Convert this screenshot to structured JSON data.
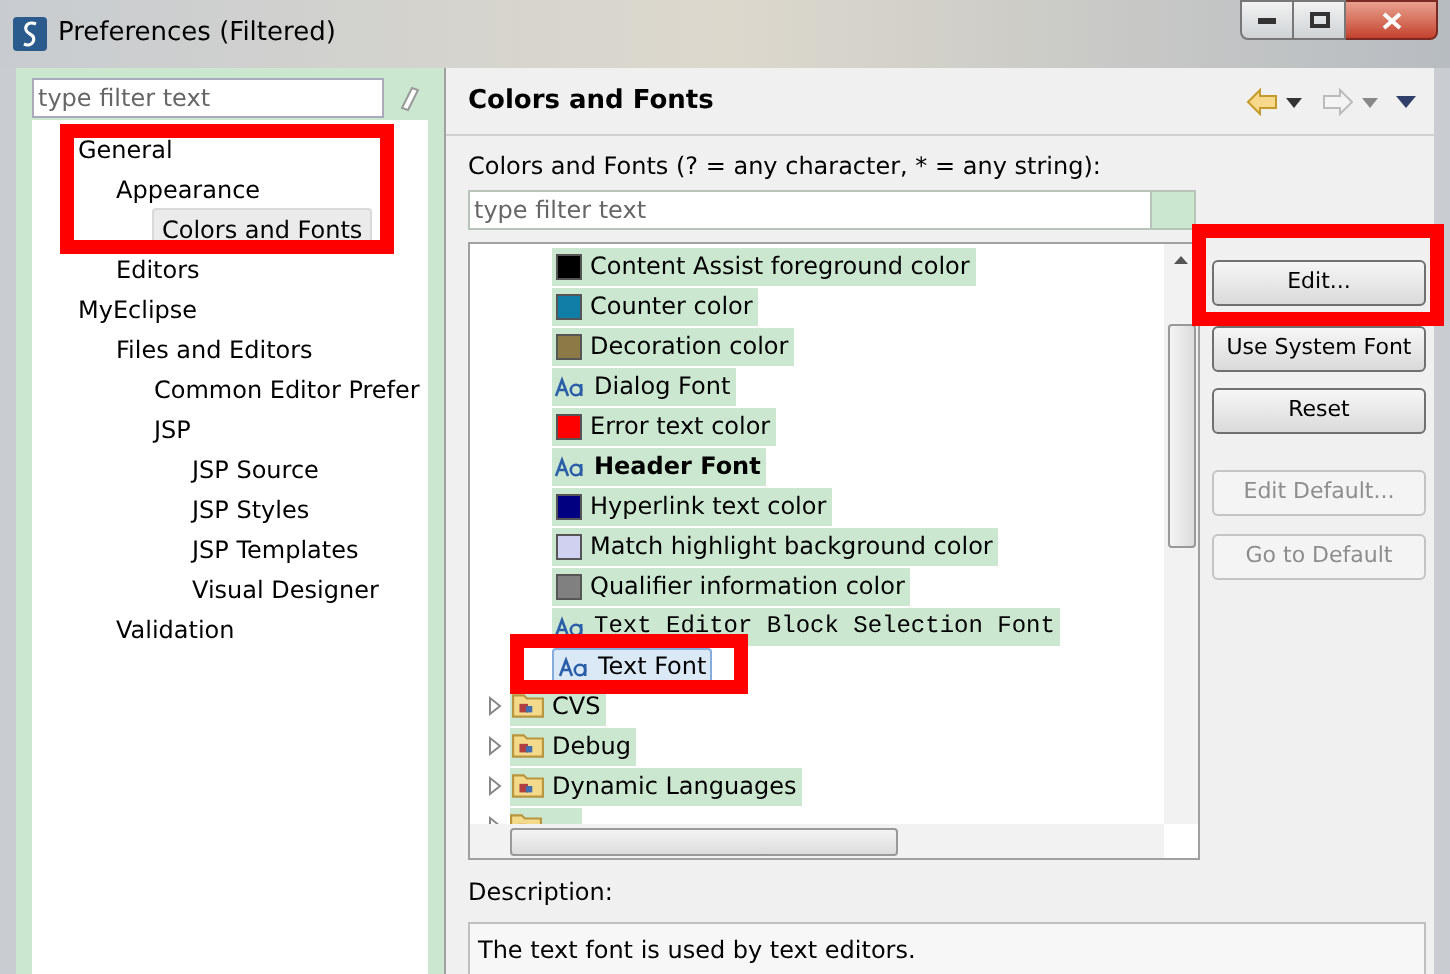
{
  "window": {
    "title": "Preferences (Filtered)"
  },
  "sidebar": {
    "filter": {
      "placeholder": "type filter text"
    },
    "items": [
      {
        "label": "General",
        "selected": false,
        "children": [
          {
            "label": "Appearance",
            "selected": false,
            "children": [
              {
                "label": "Colors and Fonts",
                "selected": true
              }
            ]
          },
          {
            "label": "Editors",
            "selected": false
          }
        ]
      },
      {
        "label": "MyEclipse",
        "selected": false,
        "children": [
          {
            "label": "Files and Editors",
            "selected": false,
            "children": [
              {
                "label": "Common Editor Prefer",
                "selected": false
              },
              {
                "label": "JSP",
                "selected": false,
                "children": [
                  {
                    "label": "JSP Source",
                    "selected": false
                  },
                  {
                    "label": "JSP Styles",
                    "selected": false
                  },
                  {
                    "label": "JSP Templates",
                    "selected": false
                  },
                  {
                    "label": "Visual Designer",
                    "selected": false
                  }
                ]
              }
            ]
          },
          {
            "label": "Validation",
            "selected": false
          }
        ]
      }
    ]
  },
  "page": {
    "title": "Colors and Fonts",
    "filter_label": "Colors and Fonts (? = any character, * = any string):",
    "filter": {
      "placeholder": "type filter text"
    },
    "tree": [
      {
        "kind": "color",
        "label": "Content Assist foreground color",
        "color": "#000000",
        "selected": false
      },
      {
        "kind": "color",
        "label": "Counter color",
        "color": "#0f7fa8",
        "selected": false
      },
      {
        "kind": "color",
        "label": "Decoration color",
        "color": "#8b7a45",
        "selected": false
      },
      {
        "kind": "font",
        "label": "Dialog Font",
        "selected": false
      },
      {
        "kind": "color",
        "label": "Error text color",
        "color": "#ff0000",
        "selected": false
      },
      {
        "kind": "bold_font",
        "label": "Header Font",
        "selected": false
      },
      {
        "kind": "color",
        "label": "Hyperlink text color",
        "color": "#000080",
        "selected": false
      },
      {
        "kind": "color",
        "label": "Match highlight background color",
        "color": "#d0d0f0",
        "selected": false
      },
      {
        "kind": "color",
        "label": "Qualifier information color",
        "color": "#808080",
        "selected": false
      },
      {
        "kind": "mono_font",
        "label": "Text Editor Block Selection Font",
        "selected": false
      },
      {
        "kind": "font",
        "label": "Text Font",
        "selected": true
      },
      {
        "kind": "category",
        "label": "CVS",
        "selected": false
      },
      {
        "kind": "category",
        "label": "Debug",
        "selected": false
      },
      {
        "kind": "category",
        "label": "Dynamic Languages",
        "selected": false
      },
      {
        "kind": "category"
      }
    ],
    "buttons": [
      {
        "label": "Edit...",
        "disabled": false
      },
      {
        "label": "Use System Font",
        "disabled": false
      },
      {
        "label": "Reset",
        "disabled": false
      },
      {
        "label": "Edit Default...",
        "disabled": true
      },
      {
        "label": "Go to Default",
        "disabled": true
      }
    ],
    "description_label": "Description:",
    "description": "The text font is used by text editors."
  }
}
